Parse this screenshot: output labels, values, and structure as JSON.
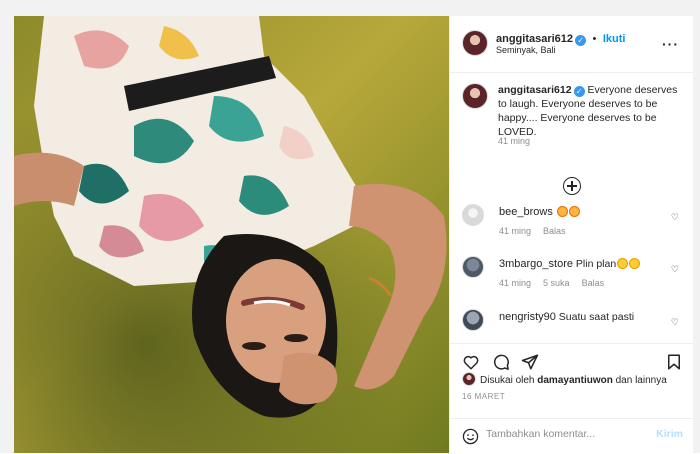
{
  "post": {
    "username": "anggitasari612",
    "follow_label": "Ikuti",
    "location": "Seminyak, Bali",
    "more_icon": "more-options-icon",
    "caption": "Everyone deserves to laugh. Everyone deserves to be happy.... Everyone deserves to be LOVED.",
    "caption_time": "41 ming"
  },
  "comments": [
    {
      "username": "bee_brows",
      "text": "",
      "time": "41 ming",
      "likes": "",
      "reply": "Balas"
    },
    {
      "username": "3mbargo_store",
      "text": "Plin plan",
      "time": "41 ming",
      "likes": "5 suka",
      "reply": "Balas"
    },
    {
      "username": "nengristy90",
      "text": "Suatu saat pasti",
      "time": "",
      "likes": "",
      "reply": ""
    }
  ],
  "likes": {
    "prefix": "Disukai oleh",
    "user": "damayantiuwon",
    "suffix": "dan lainnya"
  },
  "date": "16 MARET",
  "composer": {
    "placeholder": "Tambahkan komentar...",
    "send": "Kirim"
  },
  "colors": {
    "accent": "#0095f6",
    "verified": "#3897f0",
    "muted": "#8e8e8e"
  }
}
